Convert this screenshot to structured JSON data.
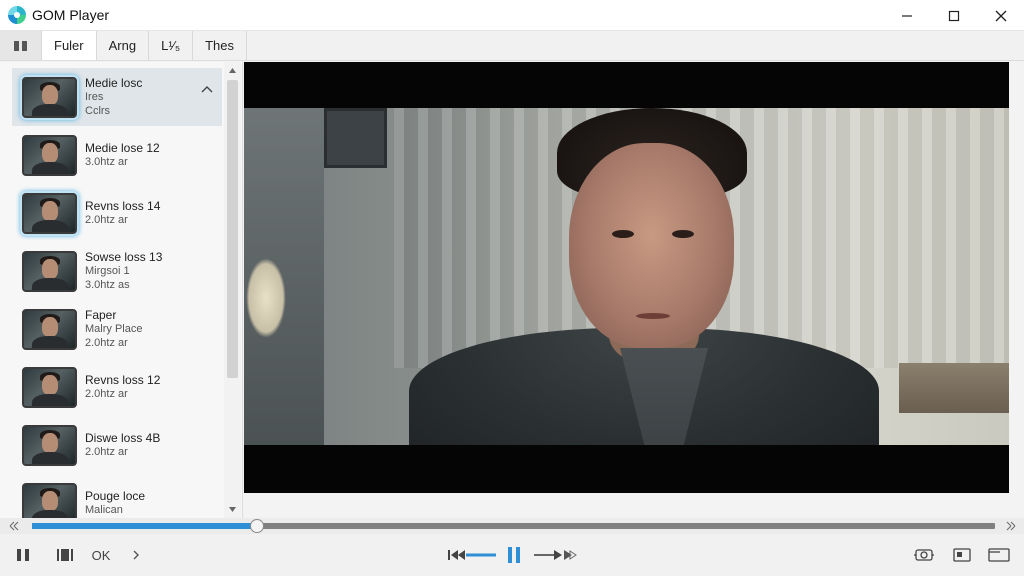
{
  "window": {
    "title": "GOM Player",
    "controls": [
      "minimize-icon",
      "maximize-icon",
      "close-icon"
    ]
  },
  "tabs": [
    {
      "label": "Fuler",
      "active": true
    },
    {
      "label": "Arng",
      "active": false
    },
    {
      "label": "L¹⁄₅",
      "active": false
    },
    {
      "label": "Thes",
      "active": false
    }
  ],
  "playlist": [
    {
      "title": "Medie losc",
      "lines": [
        "Ires",
        "Cclrs"
      ],
      "selected": true,
      "highlight": true
    },
    {
      "title": "Medie lose 12",
      "lines": [
        "3.0htz ar"
      ],
      "selected": false,
      "highlight": false
    },
    {
      "title": "Revns loss 14",
      "lines": [
        "2.0htz ar"
      ],
      "selected": false,
      "highlight": true
    },
    {
      "title": "Sowse loss 13",
      "lines": [
        "Mirgsoi 1",
        "3.0htz as"
      ],
      "selected": false,
      "highlight": false
    },
    {
      "title": "Faper",
      "lines": [
        "Malry Place",
        "2.0htz ar"
      ],
      "selected": false,
      "highlight": false
    },
    {
      "title": "Revns loss 12",
      "lines": [
        "2.0htz ar"
      ],
      "selected": false,
      "highlight": false
    },
    {
      "title": "Diswe loss 4B",
      "lines": [
        "2.0htz ar"
      ],
      "selected": false,
      "highlight": false
    },
    {
      "title": "Pouge loce",
      "lines": [
        "Malican"
      ],
      "selected": false,
      "highlight": false
    }
  ],
  "playback": {
    "progress": 0.234,
    "state": "paused",
    "ok_label": "OK"
  },
  "colors": {
    "accent": "#2f8fd6",
    "track": "#7f7f7f",
    "selected_row": "#dfe5e8"
  }
}
